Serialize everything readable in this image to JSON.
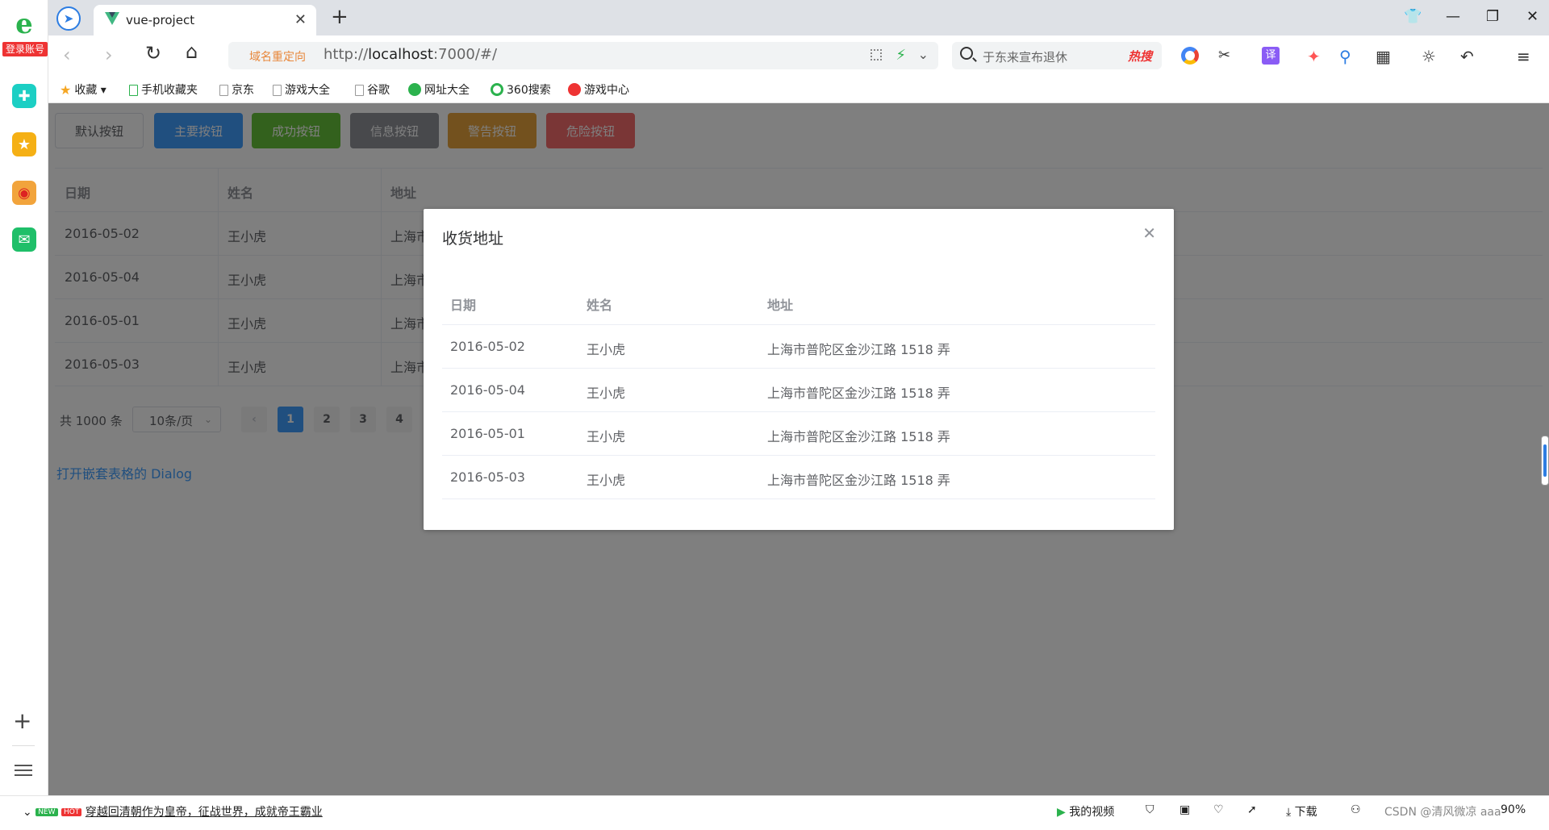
{
  "left_rail": {
    "login_label": "登录账号"
  },
  "tabbar": {
    "tab_title": "vue-project"
  },
  "address": {
    "redirect_label": "域名重定向",
    "url_prefix": "http://",
    "url_host": "localhost",
    "url_rest": ":7000/#/"
  },
  "search": {
    "placeholder": "于东来宣布退休",
    "hot_label": "热搜"
  },
  "bookmarks": [
    {
      "label": "收藏"
    },
    {
      "label": "手机收藏夹"
    },
    {
      "label": "京东"
    },
    {
      "label": "游戏大全"
    },
    {
      "label": "谷歌"
    },
    {
      "label": "网址大全"
    },
    {
      "label": "360搜索"
    },
    {
      "label": "游戏中心"
    }
  ],
  "buttons": {
    "default": "默认按钮",
    "primary": "主要按钮",
    "success": "成功按钮",
    "info": "信息按钮",
    "warning": "警告按钮",
    "danger": "危险按钮"
  },
  "table": {
    "headers": [
      "日期",
      "姓名",
      "地址"
    ],
    "rows": [
      {
        "date": "2016-05-02",
        "name": "王小虎",
        "address": "上海市"
      },
      {
        "date": "2016-05-04",
        "name": "王小虎",
        "address": "上海市"
      },
      {
        "date": "2016-05-01",
        "name": "王小虎",
        "address": "上海市"
      },
      {
        "date": "2016-05-03",
        "name": "王小虎",
        "address": "上海市"
      }
    ]
  },
  "pagination": {
    "total": "共 1000 条",
    "page_size": "10条/页",
    "pages": [
      "1",
      "2",
      "3",
      "4"
    ],
    "current": "1"
  },
  "open_link": "打开嵌套表格的 Dialog",
  "dialog": {
    "title": "收货地址",
    "headers": [
      "日期",
      "姓名",
      "地址"
    ],
    "rows": [
      {
        "date": "2016-05-02",
        "name": "王小虎",
        "address": "上海市普陀区金沙江路 1518 弄"
      },
      {
        "date": "2016-05-04",
        "name": "王小虎",
        "address": "上海市普陀区金沙江路 1518 弄"
      },
      {
        "date": "2016-05-01",
        "name": "王小虎",
        "address": "上海市普陀区金沙江路 1518 弄"
      },
      {
        "date": "2016-05-03",
        "name": "王小虎",
        "address": "上海市普陀区金沙江路 1518 弄"
      }
    ]
  },
  "statusbar": {
    "new_tag": "NEW",
    "hot_tag": "HOT",
    "news": "穿越回清朝作为皇帝，征战世界，成就帝王霸业",
    "my_video": "我的视频",
    "download": "下载",
    "watermark": "CSDN @清风微凉 aaa",
    "zoom": "90%"
  },
  "colors": {
    "primary": "#409eff",
    "success": "#67c23a",
    "info": "#909399",
    "warning": "#e6a23c",
    "danger": "#f56c6c"
  }
}
